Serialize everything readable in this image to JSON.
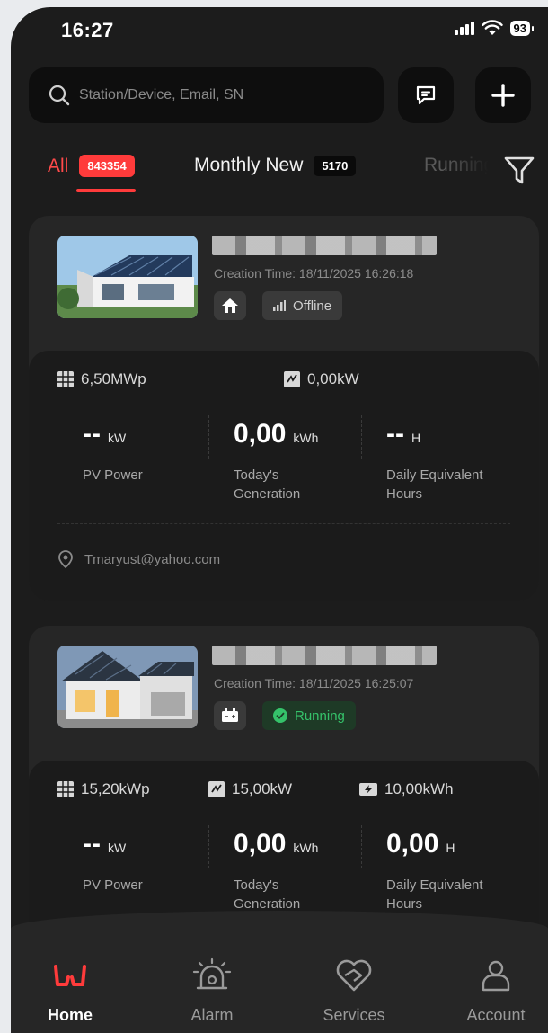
{
  "status_bar": {
    "time": "16:27",
    "battery": "93"
  },
  "search": {
    "placeholder": "Station/Device, Email, SN"
  },
  "tabs": [
    {
      "label": "All",
      "count": "843354"
    },
    {
      "label": "Monthly New",
      "count": "5170"
    },
    {
      "label": "Running"
    }
  ],
  "stations": [
    {
      "created": "Creation Time: 18/11/2025 16:26:18",
      "status": "Offline",
      "specs": {
        "capacity": "6,50MWp",
        "inverter": "0,00kW"
      },
      "pv_power": {
        "value": "--",
        "unit": "kW",
        "label": "PV Power"
      },
      "today_generation": {
        "value": "0,00",
        "unit": "kWh",
        "label": "Today's\nGeneration"
      },
      "daily_hours": {
        "value": "--",
        "unit": "H",
        "label": "Daily Equivalent\nHours"
      },
      "email": "Tmaryust@yahoo.com"
    },
    {
      "created": "Creation Time: 18/11/2025 16:25:07",
      "status": "Running",
      "specs": {
        "capacity": "15,20kWp",
        "inverter": "15,00kW",
        "storage": "10,00kWh"
      },
      "pv_power": {
        "value": "--",
        "unit": "kW",
        "label": "PV Power"
      },
      "today_generation": {
        "value": "0,00",
        "unit": "kWh",
        "label": "Today's\nGeneration"
      },
      "daily_hours": {
        "value": "0,00",
        "unit": "H",
        "label": "Daily Equivalent\nHours"
      }
    }
  ],
  "bottom_nav": [
    {
      "label": "Home",
      "icon": "home-logo-icon"
    },
    {
      "label": "Alarm",
      "icon": "alarm-icon"
    },
    {
      "label": "Services",
      "icon": "services-icon"
    },
    {
      "label": "Account",
      "icon": "account-icon"
    }
  ],
  "colors": {
    "accent": "#ff3b3b",
    "running": "#35c26a",
    "background": "#1c1c1c"
  }
}
